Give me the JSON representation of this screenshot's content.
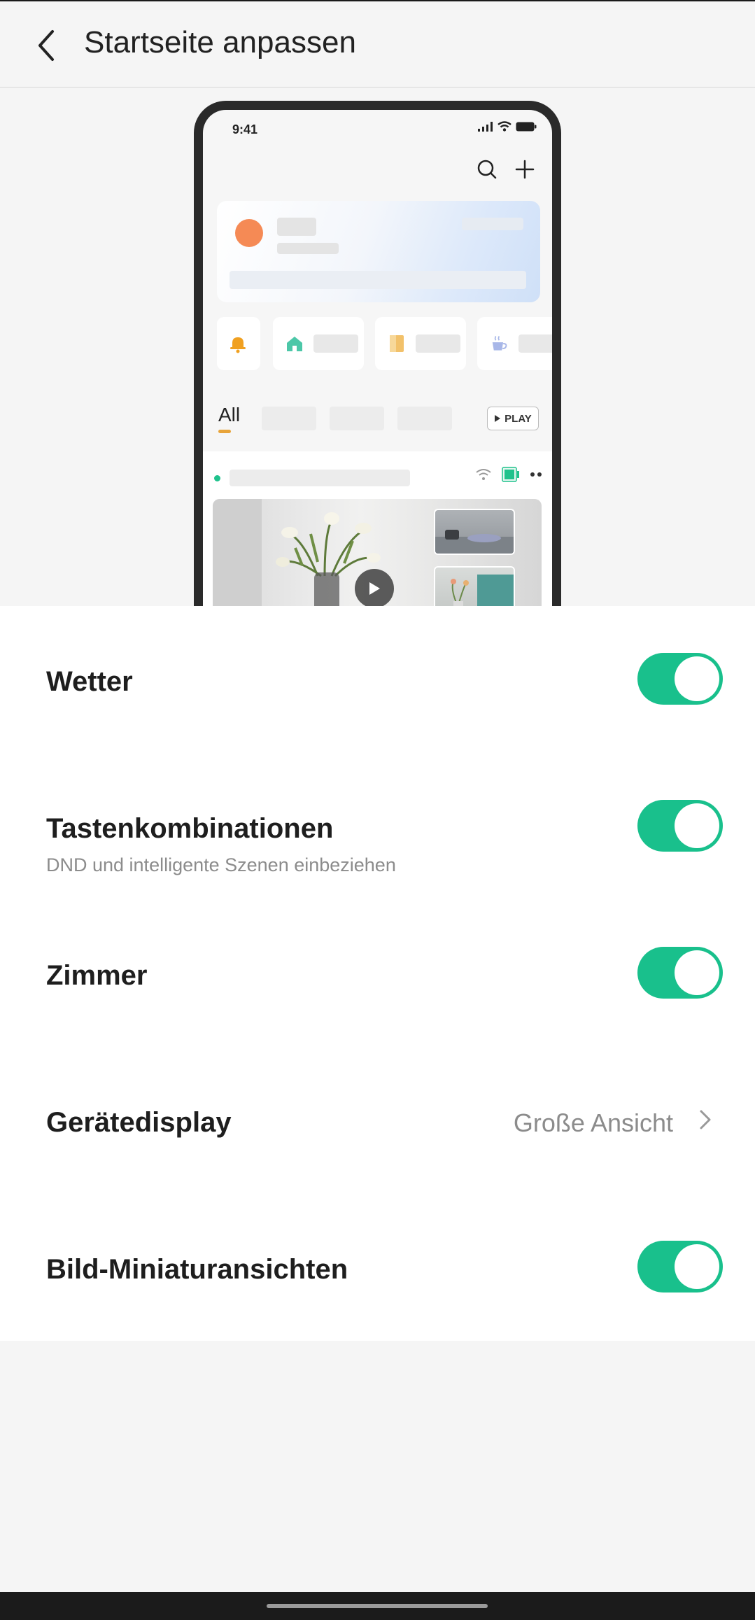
{
  "header": {
    "title": "Startseite anpassen",
    "back_icon": "chevron-left-icon"
  },
  "preview": {
    "time": "9:41",
    "tab_all": "All",
    "play_label": "PLAY",
    "icons": [
      "signal-icon",
      "wifi-icon",
      "battery-icon",
      "search-icon",
      "plus-icon",
      "bell-icon",
      "home-icon",
      "door-icon",
      "cup-icon",
      "wifi-icon",
      "camera-icon",
      "more-icon",
      "play-icon"
    ],
    "colors": {
      "avatar": "#f58a55",
      "bell": "#f0a020",
      "home": "#4cc7a8",
      "door": "#f2c16a",
      "cup": "#a8b7e8",
      "online": "#1fc28c",
      "tab_underline": "#e8a43a"
    }
  },
  "settings": {
    "items": [
      {
        "label": "Wetter",
        "type": "toggle",
        "enabled": true
      },
      {
        "label": "Tastenkombinationen",
        "sublabel": "DND und intelligente Szenen einbeziehen",
        "type": "toggle",
        "enabled": true
      },
      {
        "label": "Zimmer",
        "type": "toggle",
        "enabled": true
      },
      {
        "label": "Gerätedisplay",
        "type": "select",
        "value": "Große Ansicht"
      },
      {
        "label": "Bild-Miniaturansichten",
        "type": "toggle",
        "enabled": true
      }
    ]
  },
  "colors": {
    "accent": "#19c08c",
    "background": "#f5f5f5",
    "card": "#ffffff"
  }
}
